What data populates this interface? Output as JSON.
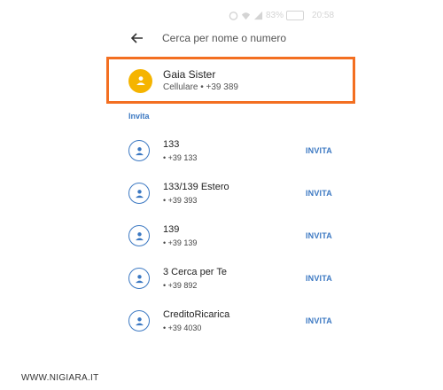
{
  "status_bar": {
    "battery": "83%",
    "time": "20:58"
  },
  "search": {
    "placeholder": "Cerca per nome o numero"
  },
  "highlighted_contact": {
    "name": "Gaia Sister",
    "detail": "Cellulare • +39 389"
  },
  "section_label": "Invita",
  "contacts": [
    {
      "name": "133",
      "number": "• +39 133",
      "action": "INVITA"
    },
    {
      "name": "133/139 Estero",
      "number": "• +39 393",
      "action": "INVITA"
    },
    {
      "name": "139",
      "number": "• +39 139",
      "action": "INVITA"
    },
    {
      "name": "3 Cerca per Te",
      "number": "• +39 892",
      "action": "INVITA"
    },
    {
      "name": "CreditoRicarica",
      "number": "• +39 4030",
      "action": "INVITA"
    }
  ],
  "watermark": "WWW.NIGIARA.IT",
  "colors": {
    "accent": "#3b78c2",
    "highlight_border": "#f36f21",
    "avatar_yellow": "#f5b400"
  }
}
